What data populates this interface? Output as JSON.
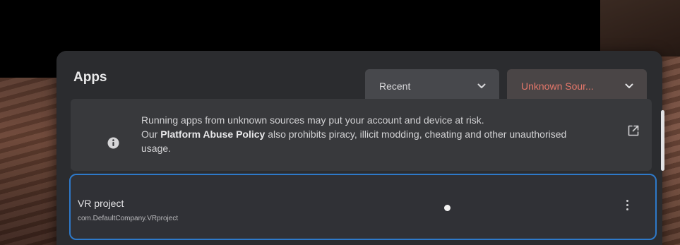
{
  "header": {
    "title": "Apps"
  },
  "filters": {
    "sort": {
      "selected": "Recent",
      "icon": "chevron-down-icon"
    },
    "source": {
      "selected": "Unknown Sour...",
      "icon": "chevron-down-icon",
      "color": "#e5776a"
    }
  },
  "banner": {
    "line1": "Running apps from unknown sources may put your account and device at risk.",
    "line2_prefix": "Our ",
    "policy_link": "Platform Abuse Policy",
    "line2_suffix": " also prohibits piracy, illicit modding, cheating and other unauthorised usage.",
    "info_icon": "info-icon",
    "external_icon": "external-link-icon"
  },
  "apps": [
    {
      "name": "VR project",
      "package": "com.DefaultCompany.VRproject",
      "menu_icon": "more-vertical-icon"
    }
  ],
  "colors": {
    "panel": "#2b2c2f",
    "selection_border": "#2e79c9",
    "warning_text": "#e5776a"
  }
}
